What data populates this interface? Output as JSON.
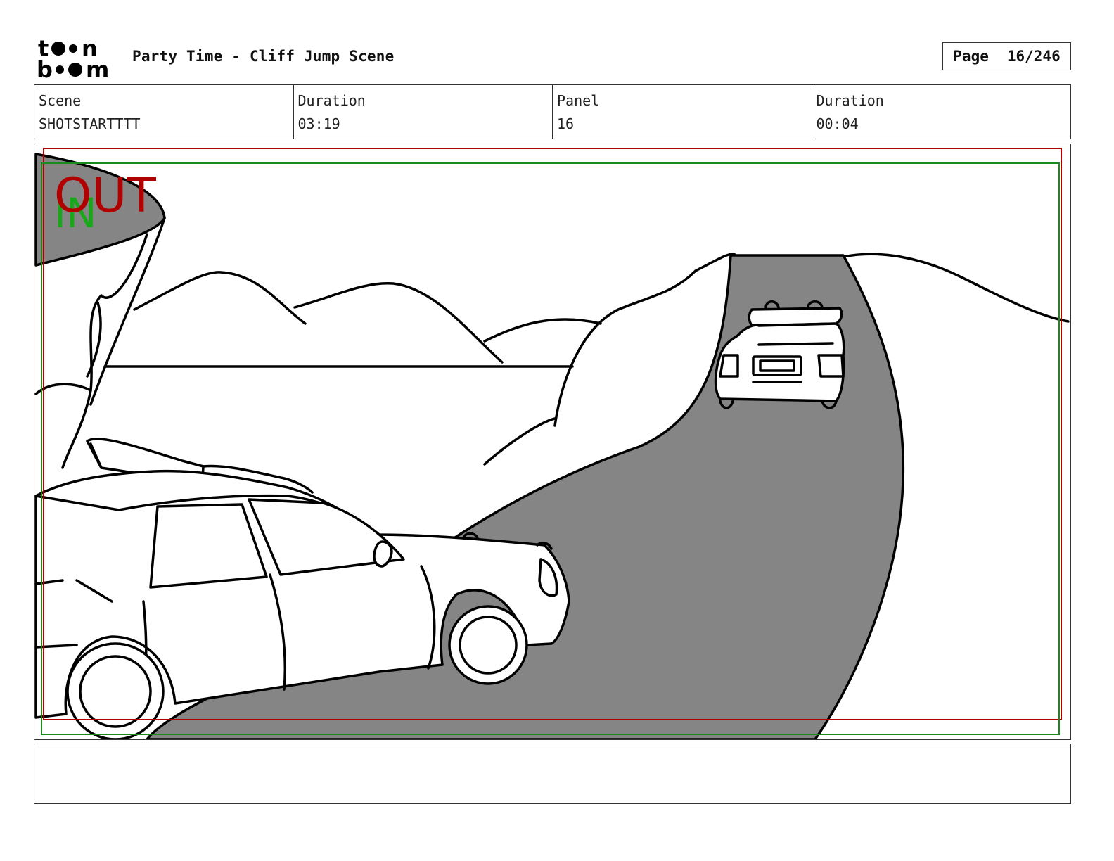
{
  "header": {
    "logo_text_top": "toon",
    "logo_text_bottom": "boom",
    "title": "Party Time - Cliff Jump Scene",
    "page_label": "Page",
    "page_value": "16/246"
  },
  "info": {
    "scene_label": "Scene",
    "scene_value": "SHOTSTARTTTT",
    "duration_label": "Duration",
    "duration_value": "03:19",
    "panel_label": "Panel",
    "panel_value": "16",
    "panel_duration_label": "Duration",
    "panel_duration_value": "00:04"
  },
  "panel": {
    "out_label": "OUT",
    "in_label": "IN",
    "colors": {
      "out_frame": "#b00000",
      "in_frame": "#1a8a1a",
      "road": "#858585",
      "ink": "#000000"
    }
  },
  "notes": {
    "text": ""
  }
}
